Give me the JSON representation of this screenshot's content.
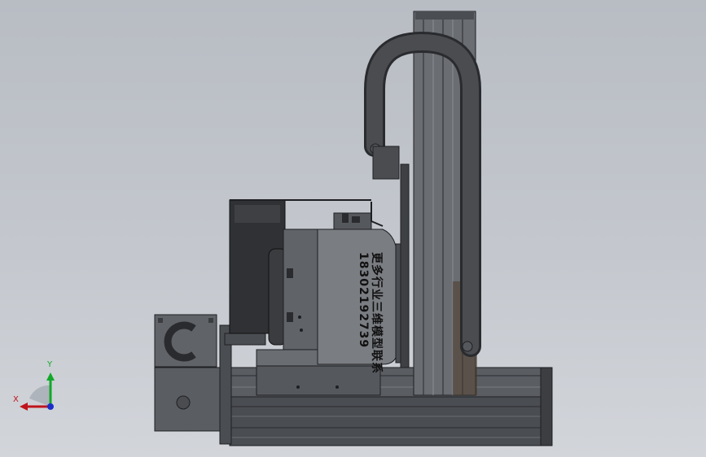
{
  "watermark": {
    "line1": "更多行业三维模型联系",
    "line2": "18302192739"
  },
  "triad": {
    "x_label": "X",
    "y_label": "Y"
  },
  "colors": {
    "background": "#c4c8ce",
    "metal_dark": "#3a3c40",
    "metal_mid": "#5c5f64",
    "metal_light": "#8a8d92",
    "x_axis": "#c0141c",
    "y_axis": "#12a82a",
    "z_axis": "#1a2ec8"
  }
}
